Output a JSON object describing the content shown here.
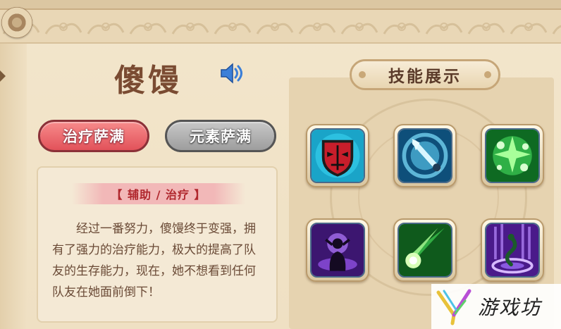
{
  "character": {
    "name": "傻馒",
    "sound_icon": "speaker-icon"
  },
  "roles": [
    {
      "label": "治疗萨满",
      "active": true
    },
    {
      "label": "元素萨满",
      "active": false
    }
  ],
  "description": {
    "tag": "【 辅助 / 治疗 】",
    "text": "经过一番努力，傻馒终于变强，拥有了强力的治疗能力，极大的提高了队友的生存能力，现在，她不想看到任何队友在她面前倒下！"
  },
  "skills": {
    "title": "技能展示",
    "items": [
      {
        "icon": "red-mask-icon"
      },
      {
        "icon": "ice-staff-icon"
      },
      {
        "icon": "green-burst-icon"
      },
      {
        "icon": "dark-summon-icon"
      },
      {
        "icon": "green-comet-icon"
      },
      {
        "icon": "purple-serpent-icon"
      }
    ]
  },
  "watermark": {
    "text": "游戏坊"
  },
  "colors": {
    "accent_red": "#e2525a",
    "inactive_gray": "#9d9d9d",
    "name_brown": "#7a4b32",
    "tag_red": "#b0282e"
  }
}
